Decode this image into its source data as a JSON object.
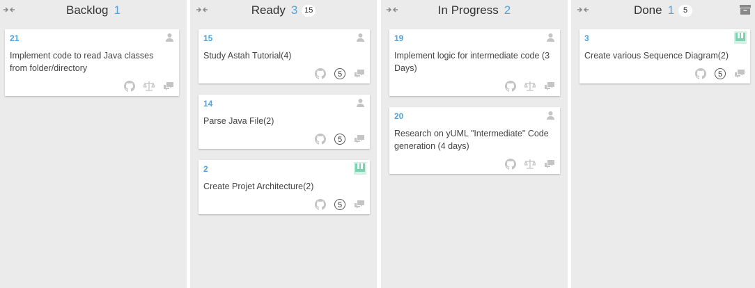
{
  "columns": [
    {
      "title": "Backlog",
      "count": "1",
      "limit": "",
      "cards": [
        {
          "number": "21",
          "title": "Implement code to read Java classes from folder/directory",
          "assignee_icon": "user-placeholder-icon",
          "footer": [
            "github-icon",
            "balance-scale-icon",
            "comments-icon"
          ],
          "points": ""
        }
      ]
    },
    {
      "title": "Ready",
      "count": "3",
      "limit": "15",
      "cards": [
        {
          "number": "15",
          "title": "Study Astah Tutorial(4)",
          "assignee_icon": "user-placeholder-icon",
          "footer": [
            "github-icon",
            "points",
            "comments-icon"
          ],
          "points": "5"
        },
        {
          "number": "14",
          "title": "Parse Java File(2)",
          "assignee_icon": "user-placeholder-icon",
          "footer": [
            "github-icon",
            "points",
            "comments-icon"
          ],
          "points": "5"
        },
        {
          "number": "2",
          "title": "Create Projet Architecture(2)",
          "assignee_icon": "waffle-logo-icon",
          "footer": [
            "github-icon",
            "points",
            "comments-icon"
          ],
          "points": "5"
        }
      ]
    },
    {
      "title": "In Progress",
      "count": "2",
      "limit": "",
      "cards": [
        {
          "number": "19",
          "title": "Implement logic for intermediate code (3 Days)",
          "assignee_icon": "user-placeholder-icon",
          "footer": [
            "github-icon",
            "balance-scale-icon",
            "comments-icon"
          ],
          "points": ""
        },
        {
          "number": "20",
          "title": "Research on yUML \"Intermediate\" Code generation (4 days)",
          "assignee_icon": "user-placeholder-icon",
          "footer": [
            "github-icon",
            "balance-scale-icon",
            "comments-icon"
          ],
          "points": ""
        }
      ]
    },
    {
      "title": "Done",
      "count": "1",
      "limit": "5",
      "cards": [
        {
          "number": "3",
          "title": "Create various Sequence Diagram(2)",
          "assignee_icon": "waffle-logo-icon",
          "footer": [
            "github-icon",
            "points",
            "comments-icon"
          ],
          "points": "5"
        }
      ]
    }
  ],
  "colors": {
    "accent": "#4ea3e0",
    "column_bg": "#ebebeb",
    "icon_gray": "#c4c4c4",
    "waffle_green": "#7dd3b0"
  }
}
